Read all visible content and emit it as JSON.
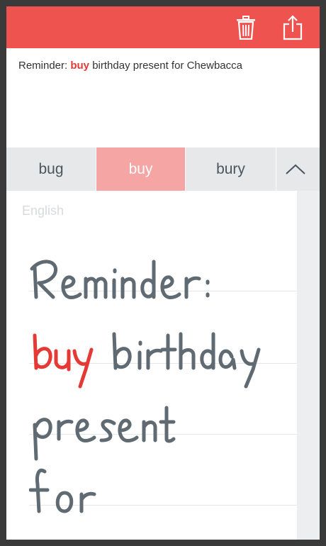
{
  "toolbar": {
    "icons": [
      "trash-icon",
      "share-icon"
    ],
    "color": "#ef5350"
  },
  "recognized": {
    "before": "Reminder: ",
    "highlight": "buy",
    "after": " birthday present for Chewbacca",
    "highlight_color": "#e53935"
  },
  "suggestions": {
    "items": [
      "bug",
      "buy",
      "bury"
    ],
    "selected": "buy",
    "collapse_icon": "chevron-up-icon"
  },
  "language": "English",
  "handwriting": {
    "lines": [
      "Reminder:",
      "buy birthday",
      "present",
      "for"
    ],
    "highlight_word": "buy",
    "ink_color": "#5f6a72",
    "highlight_color": "#e53935"
  }
}
